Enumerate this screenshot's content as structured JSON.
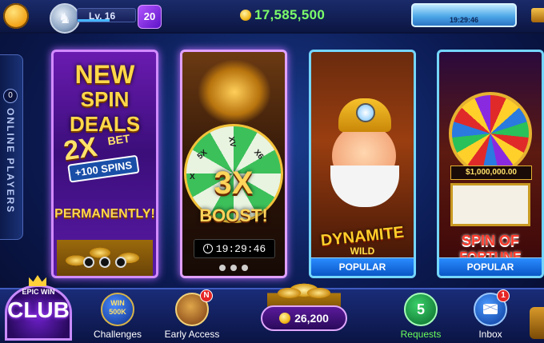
{
  "header": {
    "level_label": "Lv. 16",
    "level_progress": 0.55,
    "gems": "20",
    "balance": "17,585,500",
    "bonus_timer": "19:29:46"
  },
  "sidebar": {
    "online_count": "0",
    "online_label": "ONLINE PLAYERS"
  },
  "tiles": [
    {
      "title_line1": "NEW",
      "title_line2": "SPIN DEALS",
      "multiplier": "2X",
      "bet_word": "BET",
      "spins": "+100 SPINS",
      "footer": "PERMANENTLY!"
    },
    {
      "wheel_labels": [
        "5X",
        "XV",
        "X6",
        "X"
      ],
      "headline": "3X",
      "subline": "BOOST!",
      "timer": "19:29:46"
    },
    {
      "logo": "DYNAMITE",
      "logo_sub": "WILD",
      "badge": "POPULAR"
    },
    {
      "jackpot": "$1,000,000.00",
      "title_line1": "SPIN OF",
      "title_line2": "FORTUNE",
      "badge": "POPULAR"
    }
  ],
  "bottom_nav": {
    "club_top": "EPIC WIN",
    "club_word": "CLUB",
    "challenges_icon_text": "WIN 500K",
    "challenges_label": "Challenges",
    "early_access_badge": "N",
    "early_access_label": "Early Access",
    "collect_amount": "26,200",
    "requests_count": "5",
    "requests_label": "Requests",
    "inbox_badge": "1",
    "inbox_label": "Inbox"
  }
}
